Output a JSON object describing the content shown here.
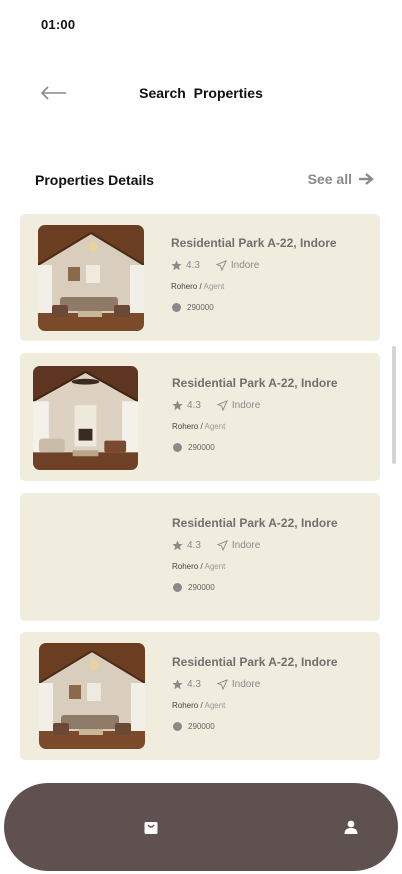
{
  "status_bar": {
    "time": "01:00"
  },
  "header": {
    "title": "Search  Properties"
  },
  "section": {
    "title": "Properties Details",
    "see_all": "See all"
  },
  "properties": [
    {
      "name": "Residential Park A-22, Indore",
      "rating": "4.3",
      "location": "Indore",
      "agent_name": "Rohero",
      "agent_sep": " / ",
      "agent_role": "Agent",
      "price": "290000",
      "has_image": true
    },
    {
      "name": "Residential Park A-22, Indore",
      "rating": "4.3",
      "location": "Indore",
      "agent_name": "Rohero",
      "agent_sep": " / ",
      "agent_role": "Agent",
      "price": "290000",
      "has_image": true
    },
    {
      "name": "Residential Park A-22, Indore",
      "rating": "4.3",
      "location": "Indore",
      "agent_name": "Rohero",
      "agent_sep": " / ",
      "agent_role": "Agent",
      "price": "290000",
      "has_image": false
    },
    {
      "name": "Residential Park A-22, Indore",
      "rating": "4.3",
      "location": "Indore",
      "agent_name": "Rohero",
      "agent_sep": " / ",
      "agent_role": "Agent",
      "price": "290000",
      "has_image": true
    }
  ],
  "bottom_nav": {
    "items": [
      {
        "icon": "shopping-bag-icon"
      },
      {
        "icon": "user-icon"
      }
    ]
  },
  "colors": {
    "card_bg": "#f0ecde",
    "nav_bg": "#5f5150"
  }
}
